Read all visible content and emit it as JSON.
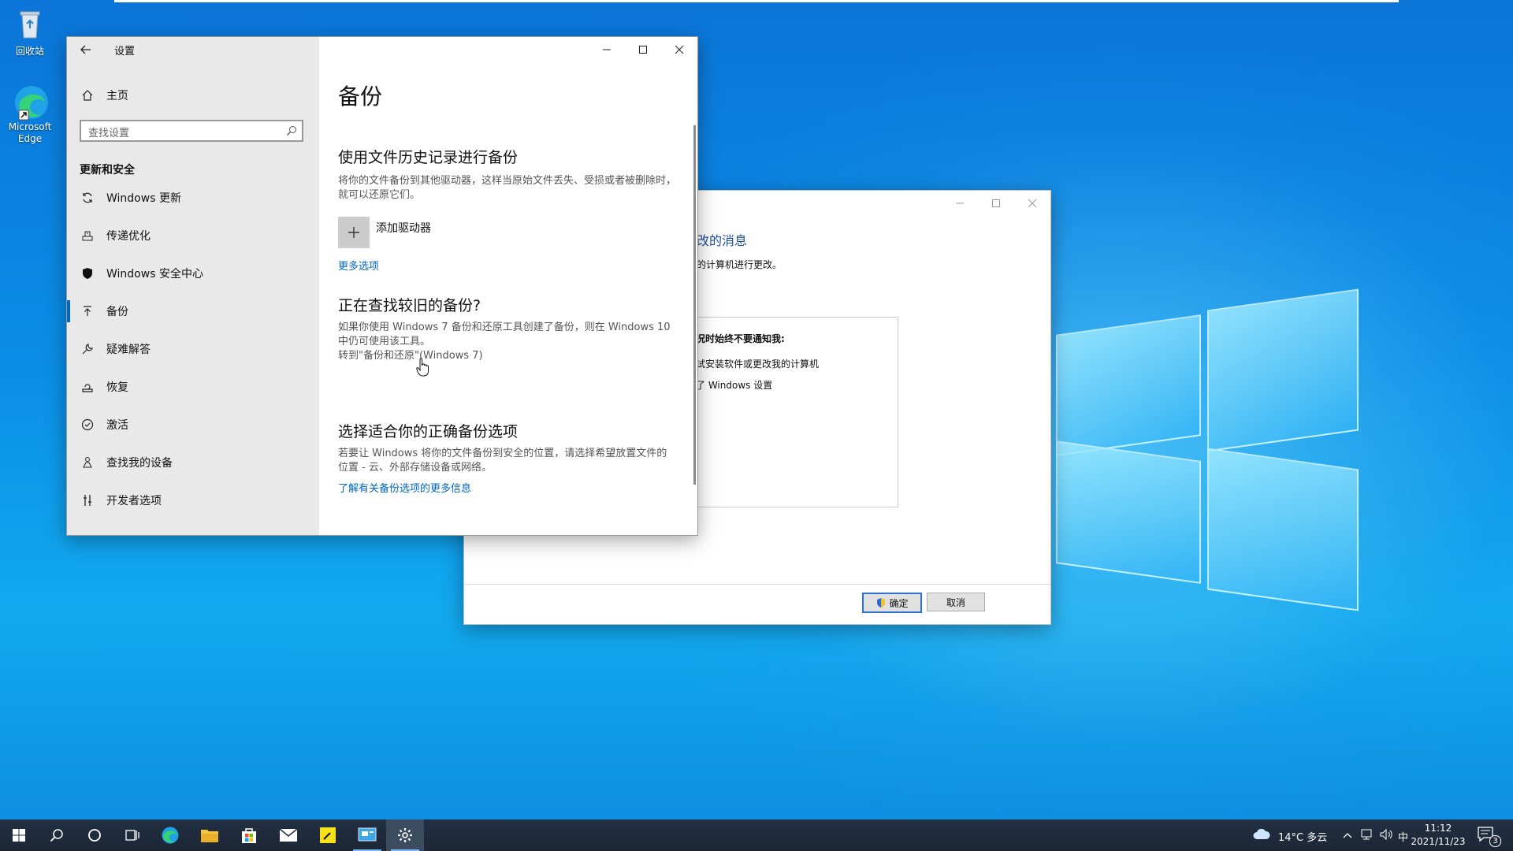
{
  "desktop": {
    "icons": [
      {
        "label": "回收站"
      },
      {
        "label": "Microsoft Edge"
      }
    ]
  },
  "uac": {
    "heading_fragment": "改的消息",
    "line1": "的计算机进行更改。",
    "box_title": "况时始终不要通知我:",
    "box_line1": "试安装软件或更改我的计算机",
    "box_line2": "了 Windows 设置",
    "box_dot": ".",
    "ok_label": "确定",
    "cancel_label": "取消"
  },
  "settings": {
    "app_title": "设置",
    "home_label": "主页",
    "search_placeholder": "查找设置",
    "section_title": "更新和安全",
    "nav_items": [
      {
        "label": "Windows 更新",
        "icon": "sync-icon"
      },
      {
        "label": "传递优化",
        "icon": "delivery-icon"
      },
      {
        "label": "Windows 安全中心",
        "icon": "shield-icon"
      },
      {
        "label": "备份",
        "icon": "upload-arrow-icon"
      },
      {
        "label": "疑难解答",
        "icon": "wrench-icon"
      },
      {
        "label": "恢复",
        "icon": "recovery-icon"
      },
      {
        "label": "激活",
        "icon": "check-circle-icon"
      },
      {
        "label": "查找我的设备",
        "icon": "person-locate-icon"
      },
      {
        "label": "开发者选项",
        "icon": "developer-icon"
      }
    ],
    "active_index": 3,
    "page_title": "备份",
    "sec1_title": "使用文件历史记录进行备份",
    "sec1_desc": "将你的文件备份到其他驱动器，这样当原始文件丢失、受损或者被删除时，就可以还原它们。",
    "add_drive_label": "添加驱动器",
    "more_options": "更多选项",
    "sec2_title": "正在查找较旧的备份?",
    "sec2_desc": "如果你使用 Windows 7 备份和还原工具创建了备份，则在 Windows 10 中仍可使用该工具。",
    "sec2_link": "转到\"备份和还原\"(Windows 7)",
    "sec3_title": "选择适合你的正确备份选项",
    "sec3_desc": "若要让 Windows 将你的文件备份到安全的位置，请选择希望放置文件的位置 - 云、外部存储设备或网络。",
    "sec3_link": "了解有关备份选项的更多信息"
  },
  "taskbar": {
    "weather": "14°C 多云",
    "ime": "中",
    "time": "11:12",
    "date": "2021/11/23",
    "notification_count": "3"
  }
}
